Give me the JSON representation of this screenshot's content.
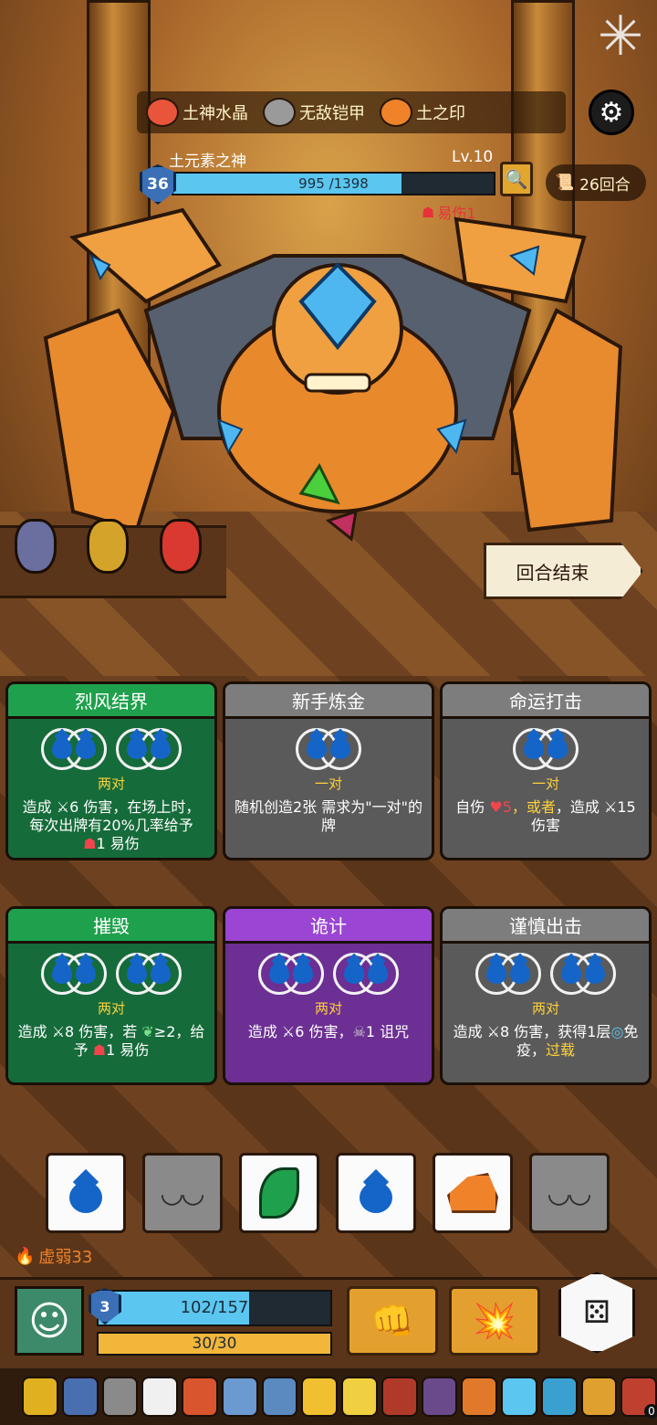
{
  "relics": [
    {
      "label": "土神水晶",
      "icon": "crystal-icon",
      "color": "#e8553a"
    },
    {
      "label": "无敌铠甲",
      "icon": "armor-icon",
      "color": "#9a9a9a"
    },
    {
      "label": "土之印",
      "icon": "seal-icon",
      "color": "#f0822a"
    }
  ],
  "boss": {
    "name": "土元素之神",
    "level": "Lv.10",
    "shield": "36",
    "hp_text": "995 /1398",
    "hp_current": 995,
    "hp_max": 1398,
    "status": "易伤1"
  },
  "round": "26回合",
  "end_turn_label": "回合结束",
  "cards": [
    {
      "title": "烈风结界",
      "style": "green",
      "pair_label": "两对",
      "text_a": "造成 ",
      "text_b": "6 伤害，在场上时，每次出牌有20%几率给予 ",
      "text_c": "1 易伤"
    },
    {
      "title": "新手炼金",
      "style": "grey",
      "pair_label": "一对",
      "text": "随机创造2张 需求为\"一对\"的牌"
    },
    {
      "title": "命运打击",
      "style": "grey",
      "pair_label": "一对",
      "text_a": "自伤 ",
      "text_b": "5",
      "text_c": "，或者",
      "text_d": "，造成 ",
      "text_e": "15 伤害"
    },
    {
      "title": "摧毁",
      "style": "green",
      "pair_label": "两对",
      "text_a": "造成 ",
      "text_b": "8 伤害，若 ",
      "text_c": "≥2，给予 ",
      "text_d": "1 易伤"
    },
    {
      "title": "诡计",
      "style": "purple",
      "pair_label": "两对",
      "text_a": "造成 ",
      "text_b": "6 伤害，",
      "text_c": "1 诅咒"
    },
    {
      "title": "谨慎出击",
      "style": "grey",
      "pair_label": "两对",
      "text_a": "造成 ",
      "text_b": "8 伤害，获得1层",
      "text_c": "免疫，",
      "text_d": "过载"
    }
  ],
  "player": {
    "weak": "虚弱33",
    "shield": "3",
    "hp_text": "102/157",
    "hp_current": 102,
    "hp_max": 157,
    "energy_text": "30/30"
  },
  "equip_count_badge": "0",
  "colors": {
    "accent_green": "#1fa04c",
    "accent_purple": "#9a45d4",
    "hp_blue": "#5bc6f0",
    "energy_gold": "#f2b63a"
  }
}
